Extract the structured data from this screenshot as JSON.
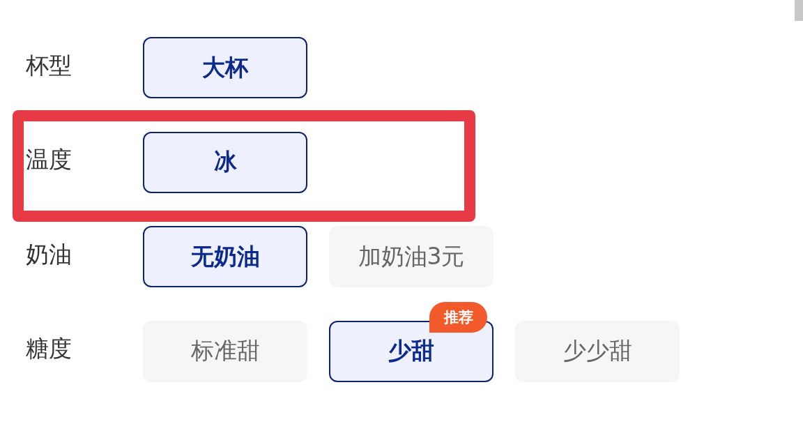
{
  "options": [
    {
      "label": "杯型",
      "highlighted": false,
      "choices": [
        {
          "text": "大杯",
          "selected": true
        }
      ]
    },
    {
      "label": "温度",
      "highlighted": true,
      "choices": [
        {
          "text": "冰",
          "selected": true
        }
      ]
    },
    {
      "label": "奶油",
      "highlighted": false,
      "choices": [
        {
          "text": "无奶油",
          "selected": true
        },
        {
          "text": "加奶油3元",
          "selected": false
        }
      ]
    },
    {
      "label": "糖度",
      "highlighted": false,
      "choices": [
        {
          "text": "标准甜",
          "selected": false
        },
        {
          "text": "少甜",
          "selected": true,
          "badge": "推荐"
        },
        {
          "text": "少少甜",
          "selected": false
        }
      ]
    }
  ]
}
